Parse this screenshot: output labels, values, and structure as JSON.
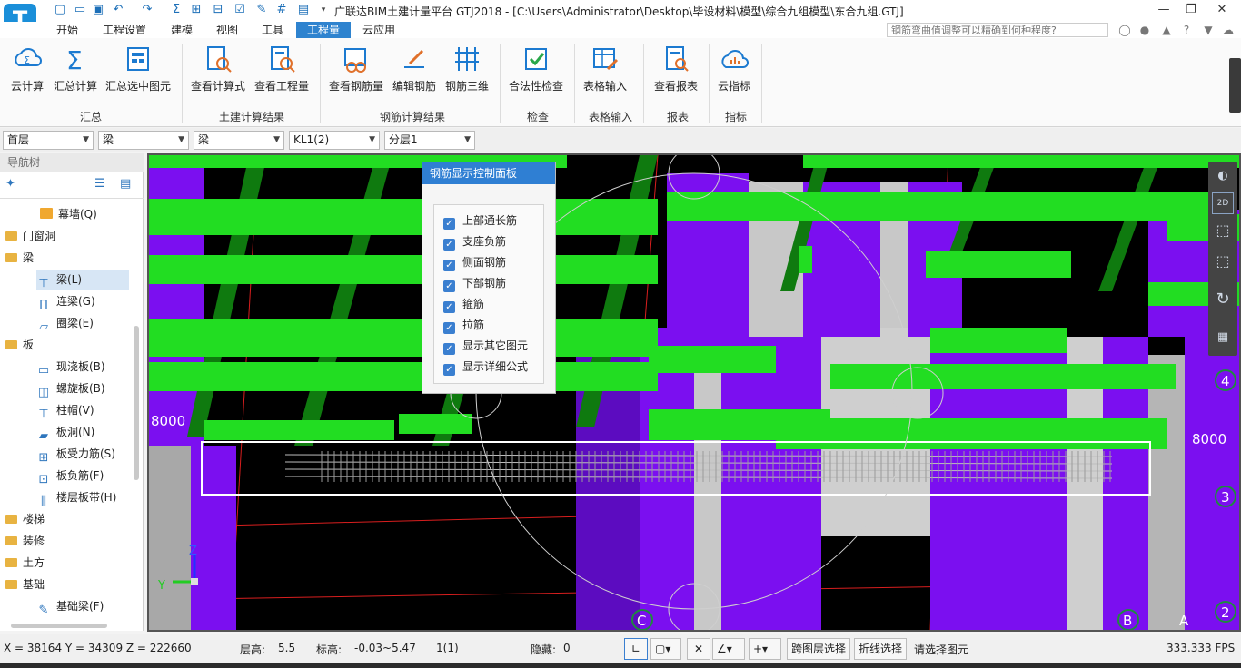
{
  "window": {
    "title": "广联达BIM土建计量平台 GTJ2018 - [C:\\Users\\Administrator\\Desktop\\毕设材料\\模型\\综合九组模型\\东合九组.GTJ]",
    "logo_letter": "T",
    "controls": {
      "minimize": "—",
      "restore": "❐",
      "close": "✕"
    }
  },
  "menu": {
    "tabs": [
      "开始",
      "工程设置",
      "建模",
      "视图",
      "工具",
      "工程量",
      "云应用"
    ],
    "active_tab": "工程量",
    "help_search_placeholder": "钢筋弯曲值调整可以精确到何种程度?"
  },
  "ribbon": {
    "buttons": [
      {
        "label": "云计算"
      },
      {
        "label": "汇总计算"
      },
      {
        "label": "汇总选中图元"
      },
      {
        "label": "查看计算式"
      },
      {
        "label": "查看工程量"
      },
      {
        "label": "查看钢筋量"
      },
      {
        "label": "编辑钢筋"
      },
      {
        "label": "钢筋三维"
      },
      {
        "label": "合法性检查"
      },
      {
        "label": "表格输入"
      },
      {
        "label": "查看报表"
      },
      {
        "label": "云指标"
      }
    ],
    "groups": [
      "汇总",
      "土建计算结果",
      "钢筋计算结果",
      "检查",
      "表格输入",
      "报表",
      "指标"
    ]
  },
  "filters": {
    "floor": "首层",
    "category": "梁",
    "type": "梁",
    "component": "KL1(2)",
    "layer": "分层1"
  },
  "nav": {
    "title": "导航树",
    "items": [
      {
        "label": "幕墙(Q)"
      },
      {
        "label": "门窗洞"
      },
      {
        "label": "梁"
      },
      {
        "label": "梁(L)"
      },
      {
        "label": "连梁(G)"
      },
      {
        "label": "圈梁(E)"
      },
      {
        "label": "板"
      },
      {
        "label": "现浇板(B)"
      },
      {
        "label": "螺旋板(B)"
      },
      {
        "label": "柱帽(V)"
      },
      {
        "label": "板洞(N)"
      },
      {
        "label": "板受力筋(S)"
      },
      {
        "label": "板负筋(F)"
      },
      {
        "label": "楼层板带(H)"
      },
      {
        "label": "楼梯"
      },
      {
        "label": "装修"
      },
      {
        "label": "土方"
      },
      {
        "label": "基础"
      },
      {
        "label": "基础梁(F)"
      }
    ],
    "selected": "梁(L)"
  },
  "rebar_panel": {
    "title": "钢筋显示控制面板",
    "options": [
      {
        "label": "上部通长筋",
        "checked": true
      },
      {
        "label": "支座负筋",
        "checked": true
      },
      {
        "label": "侧面钢筋",
        "checked": true
      },
      {
        "label": "下部钢筋",
        "checked": true
      },
      {
        "label": "箍筋",
        "checked": true
      },
      {
        "label": "拉筋",
        "checked": true
      },
      {
        "label": "显示其它图元",
        "checked": true
      },
      {
        "label": "显示详细公式",
        "checked": true
      }
    ]
  },
  "viewport": {
    "axis_labels": {
      "left_dim": "8000",
      "right_dim": "8000",
      "c": "C",
      "b": "B",
      "a": "A",
      "n4": "4",
      "n3": "3",
      "n2": "2",
      "z": "Z",
      "y": "Y"
    },
    "colors": {
      "beam": "#1ed41e",
      "column": "#7b0ff0",
      "wall": "#c8c8c8",
      "grid": "#ff2020",
      "background": "#000000"
    },
    "view_mode_label": "2D"
  },
  "status": {
    "coords": "X = 38164 Y = 34309 Z = 222660",
    "floor_height_label": "层高:",
    "floor_height": "5.5",
    "elevation_label": "标高:",
    "elevation": "-0.03~5.47",
    "selection_count": "1(1)",
    "hidden_label": "隐藏:",
    "hidden": "0",
    "cross_layer_btn": "跨图层选择",
    "polyline_btn": "折线选择",
    "hint": "请选择图元",
    "fps": "333.333 FPS"
  }
}
